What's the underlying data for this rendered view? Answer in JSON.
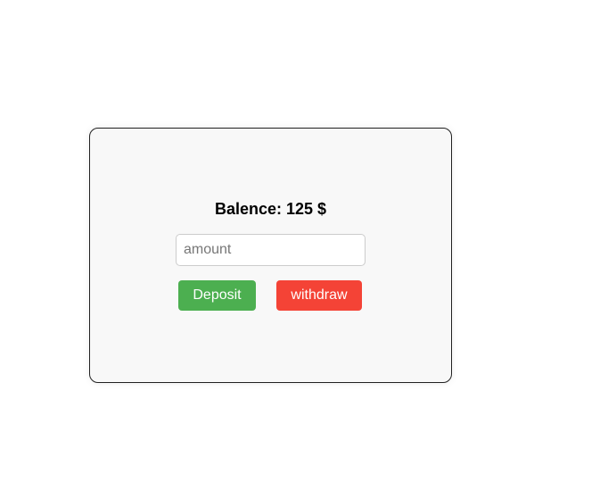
{
  "balance": {
    "label": "Balence: 125 $",
    "value": 125
  },
  "amount_input": {
    "value": "",
    "placeholder": "amount"
  },
  "buttons": {
    "deposit": "Deposit",
    "withdraw": "withdraw"
  },
  "colors": {
    "deposit": "#4caf50",
    "withdraw": "#f44336"
  }
}
